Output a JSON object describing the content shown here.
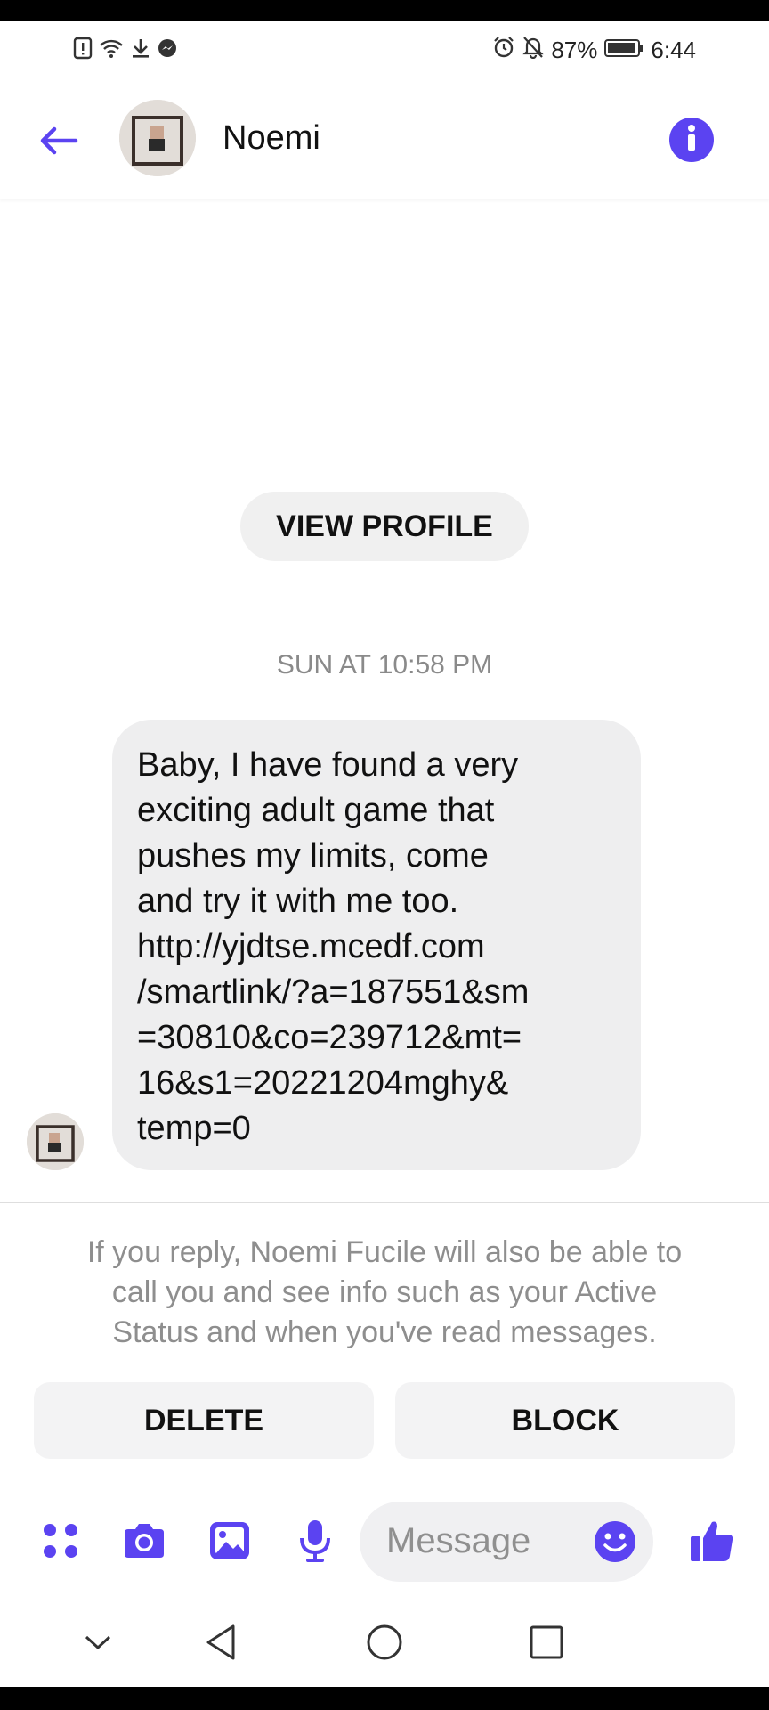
{
  "status_bar": {
    "battery_percent": "87%",
    "time": "6:44",
    "icons_left": [
      "alert-icon",
      "wifi-icon",
      "download-icon",
      "messenger-icon"
    ],
    "icons_right": [
      "alarm-icon",
      "mute-icon",
      "battery-icon"
    ]
  },
  "header": {
    "contact_name": "Noemi",
    "back_icon": "arrow-left-icon",
    "info_icon": "info-icon"
  },
  "thread": {
    "view_profile_label": "VIEW PROFILE",
    "timestamp": "SUN AT 10:58 PM",
    "message_lines": [
      "Baby, I have found a very",
      "exciting adult game that",
      "pushes my limits, come",
      "and try it with me too.",
      "http://yjdtse.mcedf.com",
      "/smartlink/?a=187551&sm",
      "=30810&co=239712&mt=",
      "16&s1=20221204mghy&",
      "temp=0"
    ]
  },
  "request_panel": {
    "notice_lines": [
      "If you reply, Noemi Fucile will also be able to",
      "call you and see info such as your Active",
      "Status and when you've read messages."
    ],
    "delete_label": "DELETE",
    "block_label": "BLOCK"
  },
  "composer": {
    "placeholder": "Message",
    "icons": [
      "apps-icon",
      "camera-icon",
      "gallery-icon",
      "microphone-icon",
      "emoji-icon",
      "thumbs-up-icon"
    ]
  },
  "nav_bar": {
    "icons": [
      "collapse-icon",
      "back-icon",
      "home-icon",
      "recents-icon"
    ]
  },
  "colors": {
    "accent": "#5b43f1",
    "bubble": "#eeeeef",
    "secondary_text": "#8e8e8e"
  }
}
